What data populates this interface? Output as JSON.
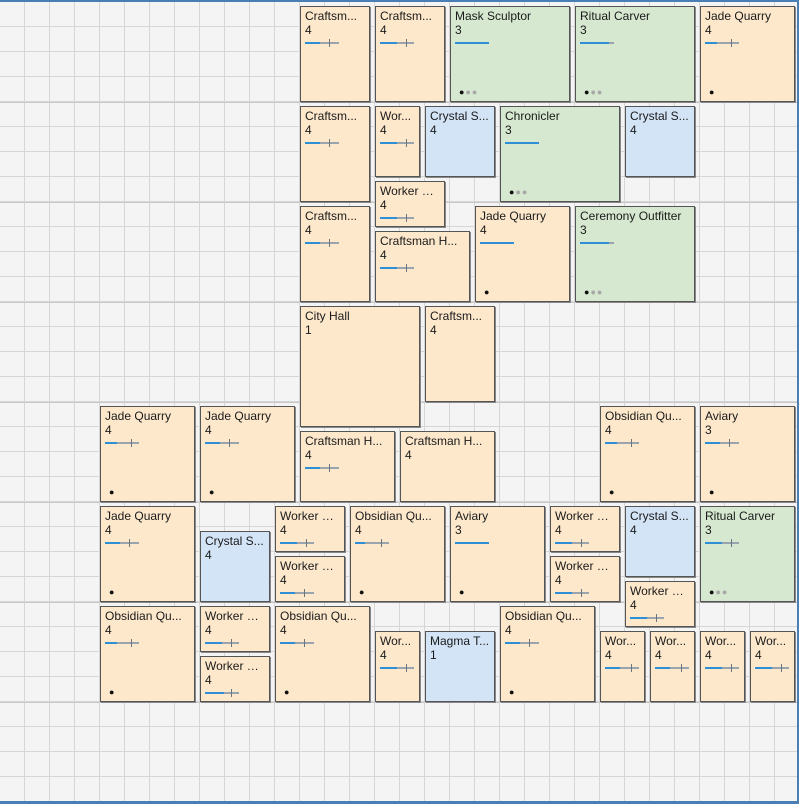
{
  "colors": {
    "residential": "#fde8cc",
    "cultural": "#d6e8cf",
    "utility": "#d3e4f7",
    "progress": "#2f8fd6",
    "frame": "#4a7fb5"
  },
  "tiles": [
    {
      "label": "Craftsm...",
      "level": "4",
      "kind": "orange",
      "bar": [
        0.45,
        0.7
      ],
      "dots": 0
    },
    {
      "label": "Craftsm...",
      "level": "4",
      "kind": "orange",
      "bar": [
        0.5,
        0.75
      ],
      "dots": 0
    },
    {
      "label": "Mask Sculptor",
      "level": "3",
      "kind": "green",
      "bar": [
        1,
        0
      ],
      "dots": 1
    },
    {
      "label": "Ritual Carver",
      "level": "3",
      "kind": "green",
      "bar": [
        0.85,
        0
      ],
      "dots": 1
    },
    {
      "label": "Jade Quarry",
      "level": "4",
      "kind": "orange",
      "bar": [
        0.35,
        0.75
      ],
      "dots": 2
    },
    {
      "label": "Craftsm...",
      "level": "4",
      "kind": "orange",
      "bar": [
        0.45,
        0.7
      ],
      "dots": 0
    },
    {
      "label": "Wor...",
      "level": "4",
      "kind": "orange",
      "bar": [
        0.5,
        0.75
      ],
      "dots": 0
    },
    {
      "label": "Crystal S...",
      "level": "4",
      "kind": "blue",
      "bar": null,
      "dots": 0
    },
    {
      "label": "Chronicler",
      "level": "3",
      "kind": "green",
      "bar": [
        1,
        0
      ],
      "dots": 1
    },
    {
      "label": "Crystal S...",
      "level": "4",
      "kind": "blue",
      "bar": null,
      "dots": 0
    },
    {
      "label": "Worker H...",
      "level": "4",
      "kind": "orange",
      "bar": [
        0.5,
        0.75
      ],
      "dots": 0
    },
    {
      "label": "Craftsm...",
      "level": "4",
      "kind": "orange",
      "bar": [
        0.45,
        0.7
      ],
      "dots": 0
    },
    {
      "label": "Craftsman H...",
      "level": "4",
      "kind": "orange",
      "bar": [
        0.5,
        0.75
      ],
      "dots": 0
    },
    {
      "label": "Jade Quarry",
      "level": "4",
      "kind": "orange",
      "bar": [
        1,
        0
      ],
      "dots": 2
    },
    {
      "label": "Ceremony Outfitter",
      "level": "3",
      "kind": "green",
      "bar": [
        0.85,
        0
      ],
      "dots": 1
    },
    {
      "label": "City Hall",
      "level": "1",
      "kind": "orange",
      "bar": null,
      "dots": 0
    },
    {
      "label": "Craftsm...",
      "level": "4",
      "kind": "orange",
      "bar": null,
      "dots": 0
    },
    {
      "label": "Jade Quarry",
      "level": "4",
      "kind": "orange",
      "bar": [
        0.35,
        0.75
      ],
      "dots": 2
    },
    {
      "label": "Jade Quarry",
      "level": "4",
      "kind": "orange",
      "bar": [
        0.45,
        0.7
      ],
      "dots": 2
    },
    {
      "label": "Craftsman H...",
      "level": "4",
      "kind": "orange",
      "bar": [
        0.45,
        0.7
      ],
      "dots": 0
    },
    {
      "label": "Craftsman H...",
      "level": "4",
      "kind": "orange",
      "bar": null,
      "dots": 0
    },
    {
      "label": "Obsidian Qu...",
      "level": "4",
      "kind": "orange",
      "bar": [
        0.35,
        0.75
      ],
      "dots": 2
    },
    {
      "label": "Aviary",
      "level": "3",
      "kind": "orange",
      "bar": [
        0.45,
        0.7
      ],
      "dots": 2
    },
    {
      "label": "Jade Quarry",
      "level": "4",
      "kind": "orange",
      "bar": [
        0.45,
        0.7
      ],
      "dots": 2
    },
    {
      "label": "Worker H...",
      "level": "4",
      "kind": "orange",
      "bar": [
        0.5,
        0.75
      ],
      "dots": 0
    },
    {
      "label": "Obsidian Qu...",
      "level": "4",
      "kind": "orange",
      "bar": [
        0.3,
        0.75
      ],
      "dots": 2
    },
    {
      "label": "Aviary",
      "level": "3",
      "kind": "orange",
      "bar": [
        1,
        0
      ],
      "dots": 2
    },
    {
      "label": "Worker H...",
      "level": "4",
      "kind": "orange",
      "bar": [
        0.5,
        0.75
      ],
      "dots": 0
    },
    {
      "label": "Crystal S...",
      "level": "4",
      "kind": "blue",
      "bar": null,
      "dots": 0
    },
    {
      "label": "Ritual Carver",
      "level": "3",
      "kind": "green",
      "bar": [
        0.5,
        0.75
      ],
      "dots": 1
    },
    {
      "label": "Crystal S...",
      "level": "4",
      "kind": "blue",
      "bar": null,
      "dots": 0
    },
    {
      "label": "Worker H...",
      "level": "4",
      "kind": "orange",
      "bar": [
        0.45,
        0.7
      ],
      "dots": 0
    },
    {
      "label": "Worker H...",
      "level": "4",
      "kind": "orange",
      "bar": [
        0.5,
        0.75
      ],
      "dots": 0
    },
    {
      "label": "Worker H...",
      "level": "4",
      "kind": "orange",
      "bar": [
        0.5,
        0.75
      ],
      "dots": 0
    },
    {
      "label": "Obsidian Qu...",
      "level": "4",
      "kind": "orange",
      "bar": [
        0.35,
        0.75
      ],
      "dots": 2
    },
    {
      "label": "Worker H...",
      "level": "4",
      "kind": "orange",
      "bar": [
        0.5,
        0.75
      ],
      "dots": 0
    },
    {
      "label": "Worker H...",
      "level": "4",
      "kind": "orange",
      "bar": [
        0.55,
        0.75
      ],
      "dots": 0
    },
    {
      "label": "Obsidian Qu...",
      "level": "4",
      "kind": "orange",
      "bar": [
        0.45,
        0.7
      ],
      "dots": 2
    },
    {
      "label": "Wor...",
      "level": "4",
      "kind": "orange",
      "bar": [
        0.5,
        0.75
      ],
      "dots": 0
    },
    {
      "label": "Magma T...",
      "level": "1",
      "kind": "blue",
      "bar": null,
      "dots": 0
    },
    {
      "label": "Obsidian Qu...",
      "level": "4",
      "kind": "orange",
      "bar": [
        0.45,
        0.7
      ],
      "dots": 2
    },
    {
      "label": "Wor...",
      "level": "4",
      "kind": "orange",
      "bar": [
        0.45,
        0.75
      ],
      "dots": 0
    },
    {
      "label": "Wor...",
      "level": "4",
      "kind": "orange",
      "bar": [
        0.45,
        0.75
      ],
      "dots": 0
    },
    {
      "label": "Wor...",
      "level": "4",
      "kind": "orange",
      "bar": [
        0.5,
        0.75
      ],
      "dots": 0
    },
    {
      "label": "Wor...",
      "level": "4",
      "kind": "orange",
      "bar": [
        0.5,
        0.75
      ],
      "dots": 0
    }
  ]
}
